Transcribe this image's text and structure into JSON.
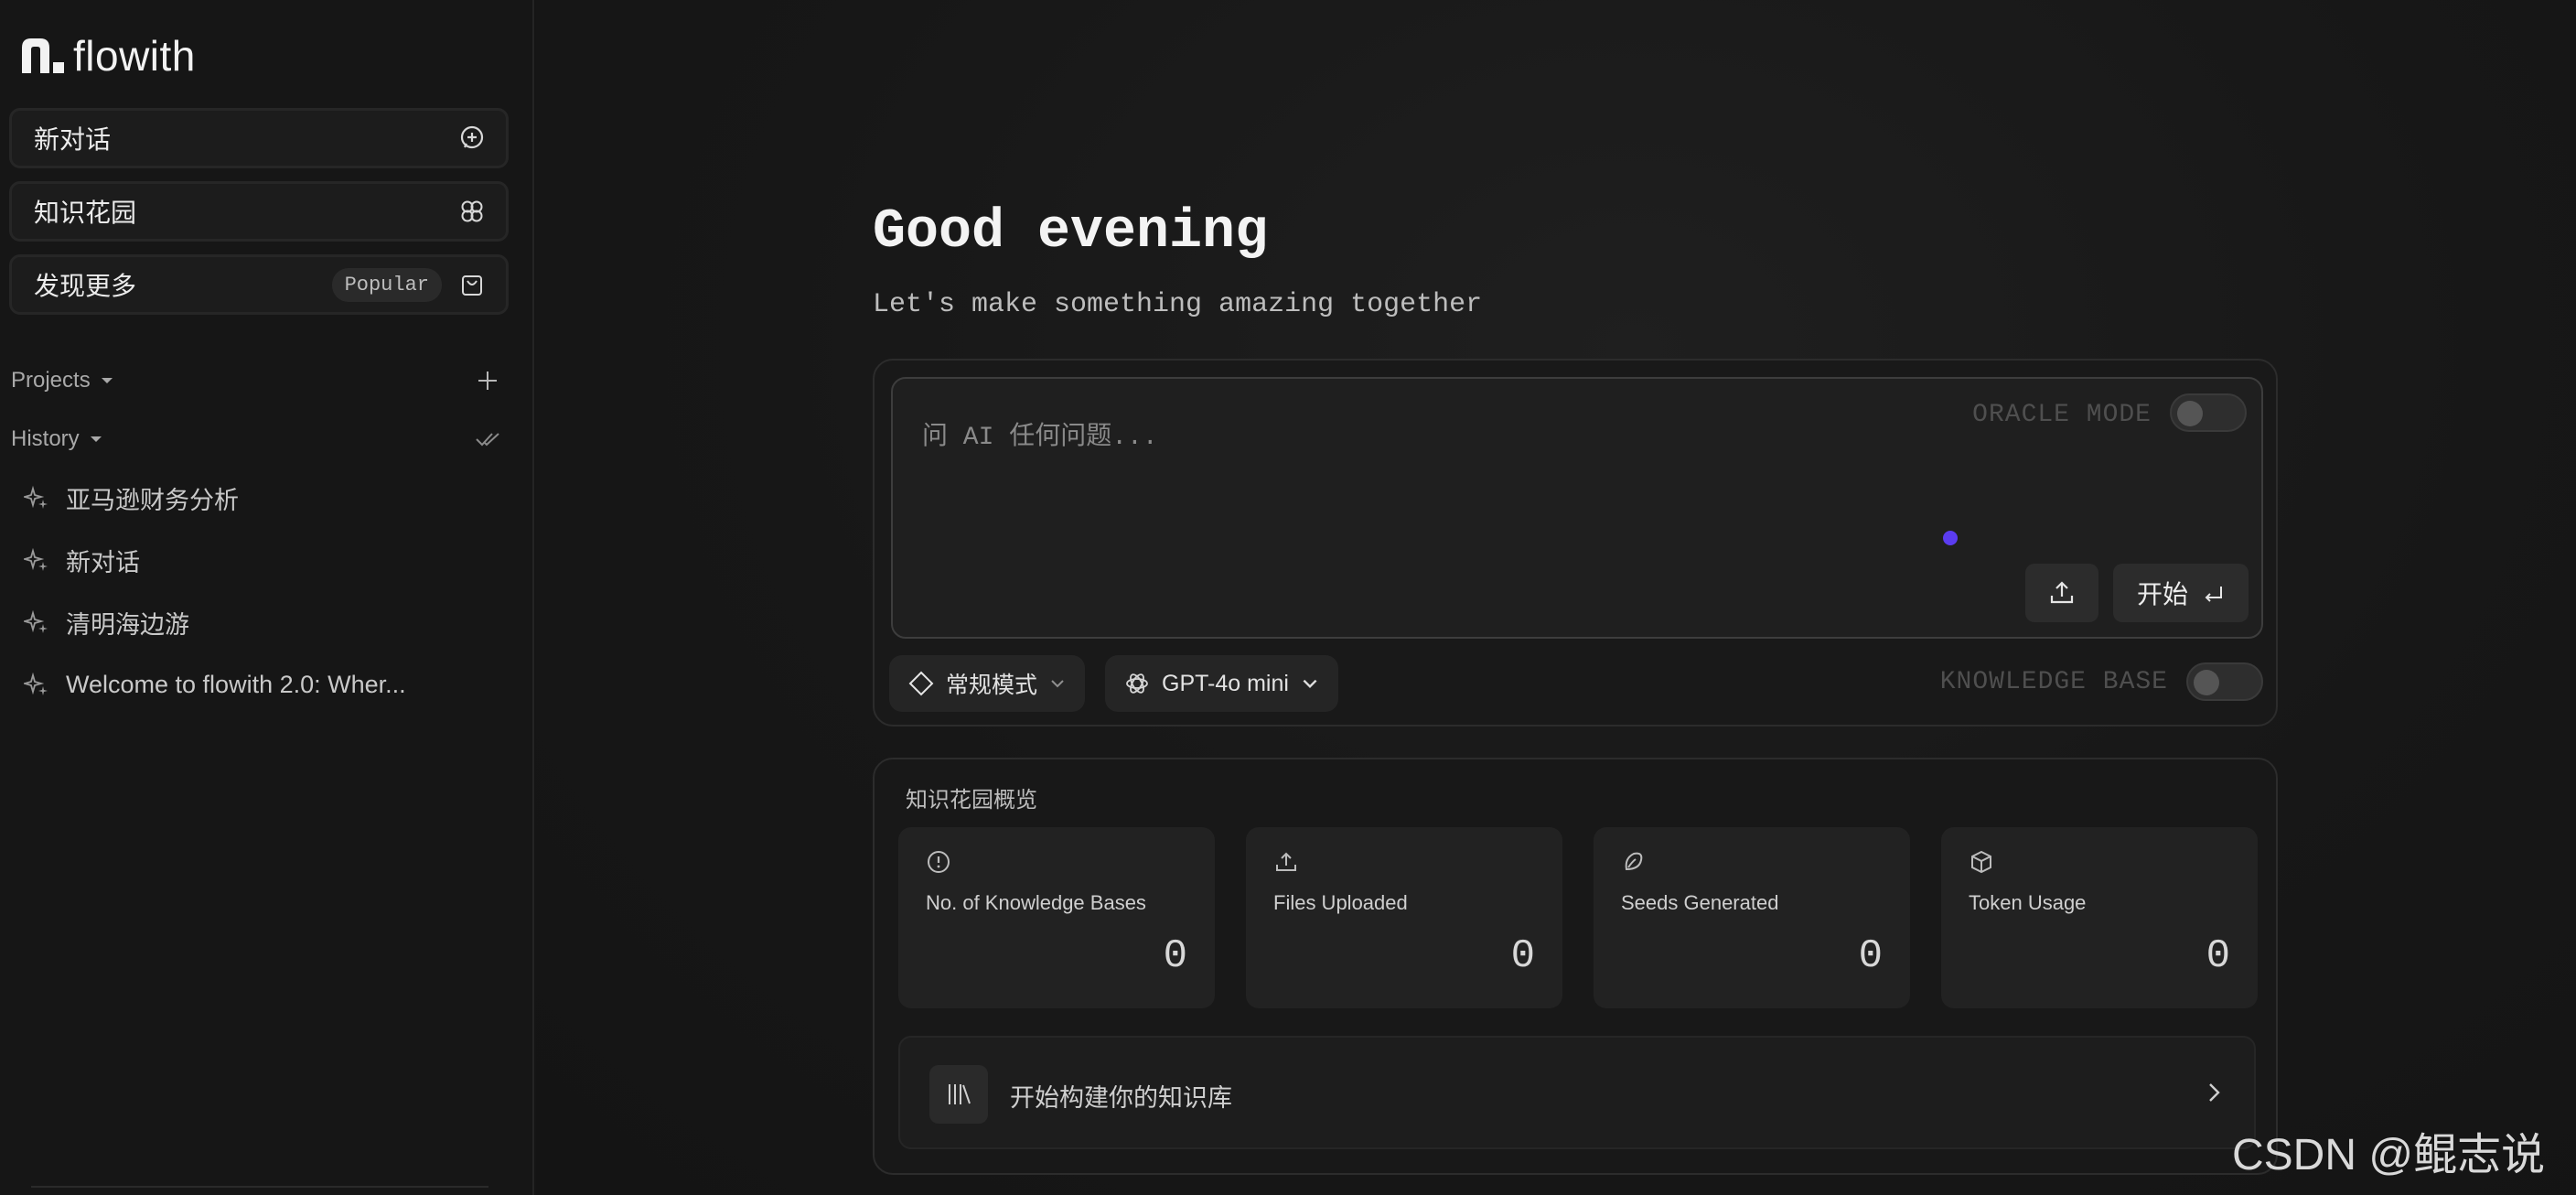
{
  "app": {
    "name": "flowith"
  },
  "sidebar": {
    "new_chat": "新对话",
    "knowledge_garden": "知识花园",
    "discover": "发现更多",
    "popular_badge": "Popular",
    "projects_label": "Projects",
    "history_label": "History",
    "history_items": [
      "亚马逊财务分析",
      "新对话",
      "清明海边游",
      "Welcome to flowith 2.0: Wher..."
    ]
  },
  "main": {
    "greeting": "Good evening",
    "subgreeting": "Let's make something amazing together",
    "composer": {
      "placeholder": "问 AI 任何问题...",
      "oracle_mode": "ORACLE MODE",
      "start_label": "开始",
      "mode_select": "常规模式",
      "model_select": "GPT-4o mini",
      "knowledge_base": "KNOWLEDGE BASE"
    },
    "overview": {
      "title": "知识花园概览",
      "stats": [
        {
          "label": "No. of Knowledge Bases",
          "value": "0",
          "icon": "info-icon"
        },
        {
          "label": "Files Uploaded",
          "value": "0",
          "icon": "upload-icon"
        },
        {
          "label": "Seeds Generated",
          "value": "0",
          "icon": "seed-icon"
        },
        {
          "label": "Token Usage",
          "value": "0",
          "icon": "cube-icon"
        }
      ],
      "build_cta": "开始构建你的知识库"
    }
  },
  "watermark": "CSDN @鲲志说",
  "colors": {
    "accent_dot": "#5b3cf0",
    "background": "#151515"
  }
}
